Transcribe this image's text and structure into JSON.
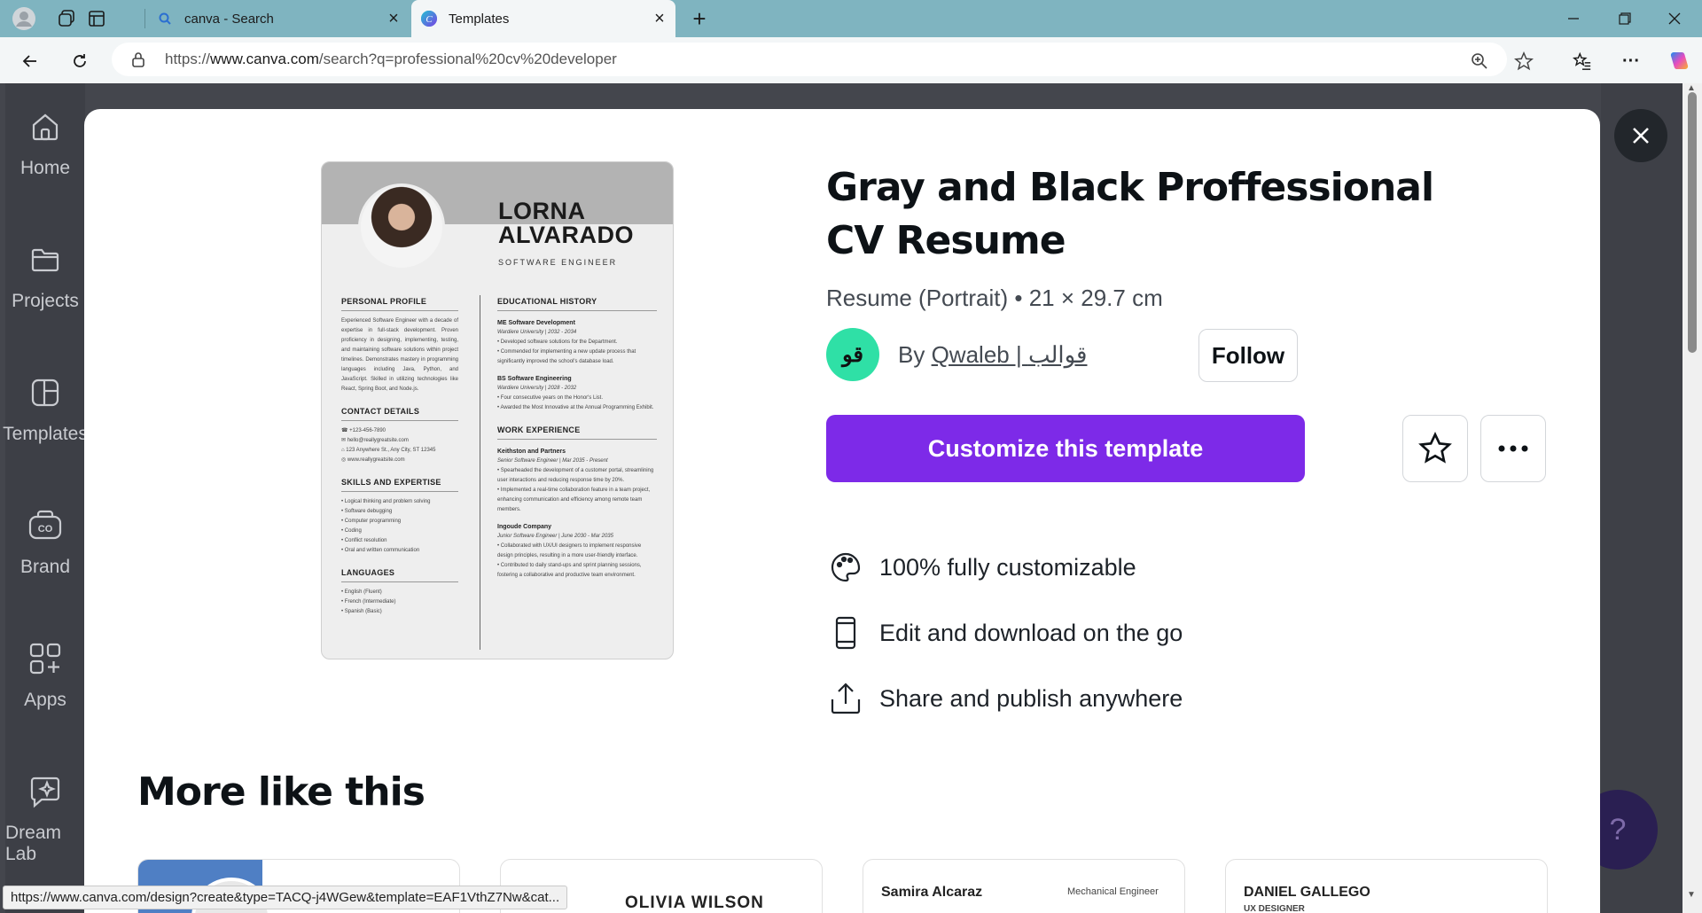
{
  "browser": {
    "tabs": [
      {
        "title": "canva - Search",
        "active": false
      },
      {
        "title": "Templates",
        "active": true
      }
    ],
    "url_prefix": "https://",
    "url_host": "www.canva.com",
    "url_path": "/search?q=professional%20cv%20developer",
    "status_url": "https://www.canva.com/design?create&type=TACQ-j4WGew&template=EAF1VthZ7Nw&cat..."
  },
  "left_rail": [
    {
      "label": "Home",
      "icon": "home-icon"
    },
    {
      "label": "Projects",
      "icon": "folder-icon"
    },
    {
      "label": "Templates",
      "icon": "template-icon"
    },
    {
      "label": "Brand",
      "icon": "brand-icon"
    },
    {
      "label": "Apps",
      "icon": "apps-icon"
    },
    {
      "label": "Dream Lab",
      "icon": "dream-lab-icon"
    }
  ],
  "help_label": "?",
  "template": {
    "title": "Gray and Black Proffessional CV Resume",
    "meta": "Resume (Portrait) • 21 × 29.7 cm",
    "by_prefix": "By ",
    "creator": "Qwaleb | قوالب",
    "creator_avatar": "قو",
    "follow_label": "Follow",
    "customize_label": "Customize this template",
    "features": [
      {
        "label": "100% fully customizable",
        "icon": "palette-icon"
      },
      {
        "label": "Edit and download on the go",
        "icon": "mobile-icon"
      },
      {
        "label": "Share and publish anywhere",
        "icon": "share-icon"
      }
    ]
  },
  "preview": {
    "name_line1": "LORNA",
    "name_line2": "ALVARADO",
    "role": "SOFTWARE ENGINEER",
    "profile_heading": "PERSONAL PROFILE",
    "profile_text": "Experienced Software Engineer with a decade of expertise in full-stack development. Proven proficiency in designing, implementing, testing, and maintaining software solutions within project timelines. Demonstrates mastery in programming languages including Java, Python, and JavaScript. Skilled in utilizing technologies like React, Spring Boot, and Node.js.",
    "contact_heading": "CONTACT DETAILS",
    "contact": [
      "+123-456-7890",
      "hello@reallygreatsite.com",
      "123 Anywhere St., Any City, ST 12345",
      "www.reallygreatsite.com"
    ],
    "skills_heading": "SKILLS AND EXPERTISE",
    "skills": [
      "Logical thinking and problem solving",
      "Software debugging",
      "Computer programming",
      "Coding",
      "Conflict resolution",
      "Oral and written communication"
    ],
    "languages_heading": "LANGUAGES",
    "languages": [
      "English (Fluent)",
      "French (Intermediate)",
      "Spanish (Basic)"
    ],
    "education_heading": "EDUCATIONAL HISTORY",
    "edu1_title": "ME Software Development",
    "edu1_sub": "Wardiere University | 2032 - 2034",
    "edu1_b1": "Developed software solutions for the Department.",
    "edu1_b2": "Commended for implementing a new update process that significantly improved the school's database load.",
    "edu2_title": "BS Software Engineering",
    "edu2_sub": "Wardiere University | 2028 - 2032",
    "edu2_b1": "Four consecutive years on the Honor's List.",
    "edu2_b2": "Awarded the Most Innovative at the Annual Programming Exhibit.",
    "work_heading": "WORK EXPERIENCE",
    "job1_title": "Keithston and Partners",
    "job1_sub": "Senior Software Engineer | Mar 2035 - Present",
    "job1_b1": "Spearheaded the development of a customer portal, streamlining user interactions and reducing response time by 20%.",
    "job1_b2": "Implemented a real-time collaboration feature in a team project, enhancing communication and efficiency among remote team members.",
    "job2_title": "Ingoude Company",
    "job2_sub": "Junior Software Engineer | June 2030 - Mar 2035",
    "job2_b1": "Collaborated with UX/UI designers to implement responsive design principles, resulting in a more user-friendly interface.",
    "job2_b2": "Contributed to daily stand-ups and sprint planning sessions, fostering a collaborative and productive team environment."
  },
  "more_like_this": {
    "title": "More like this",
    "cards": [
      {
        "text": ""
      },
      {
        "text": "OLIVIA WILSON"
      },
      {
        "text": "Samira Alcaraz",
        "subtext": "Mechanical Engineer"
      },
      {
        "text": "DANIEL GALLEGO",
        "subtext": "UX DESIGNER"
      }
    ]
  },
  "colors": {
    "accent": "#7d2ae8",
    "creator_avatar": "#2fe0a6",
    "tabbar": "#7fb4c0"
  }
}
